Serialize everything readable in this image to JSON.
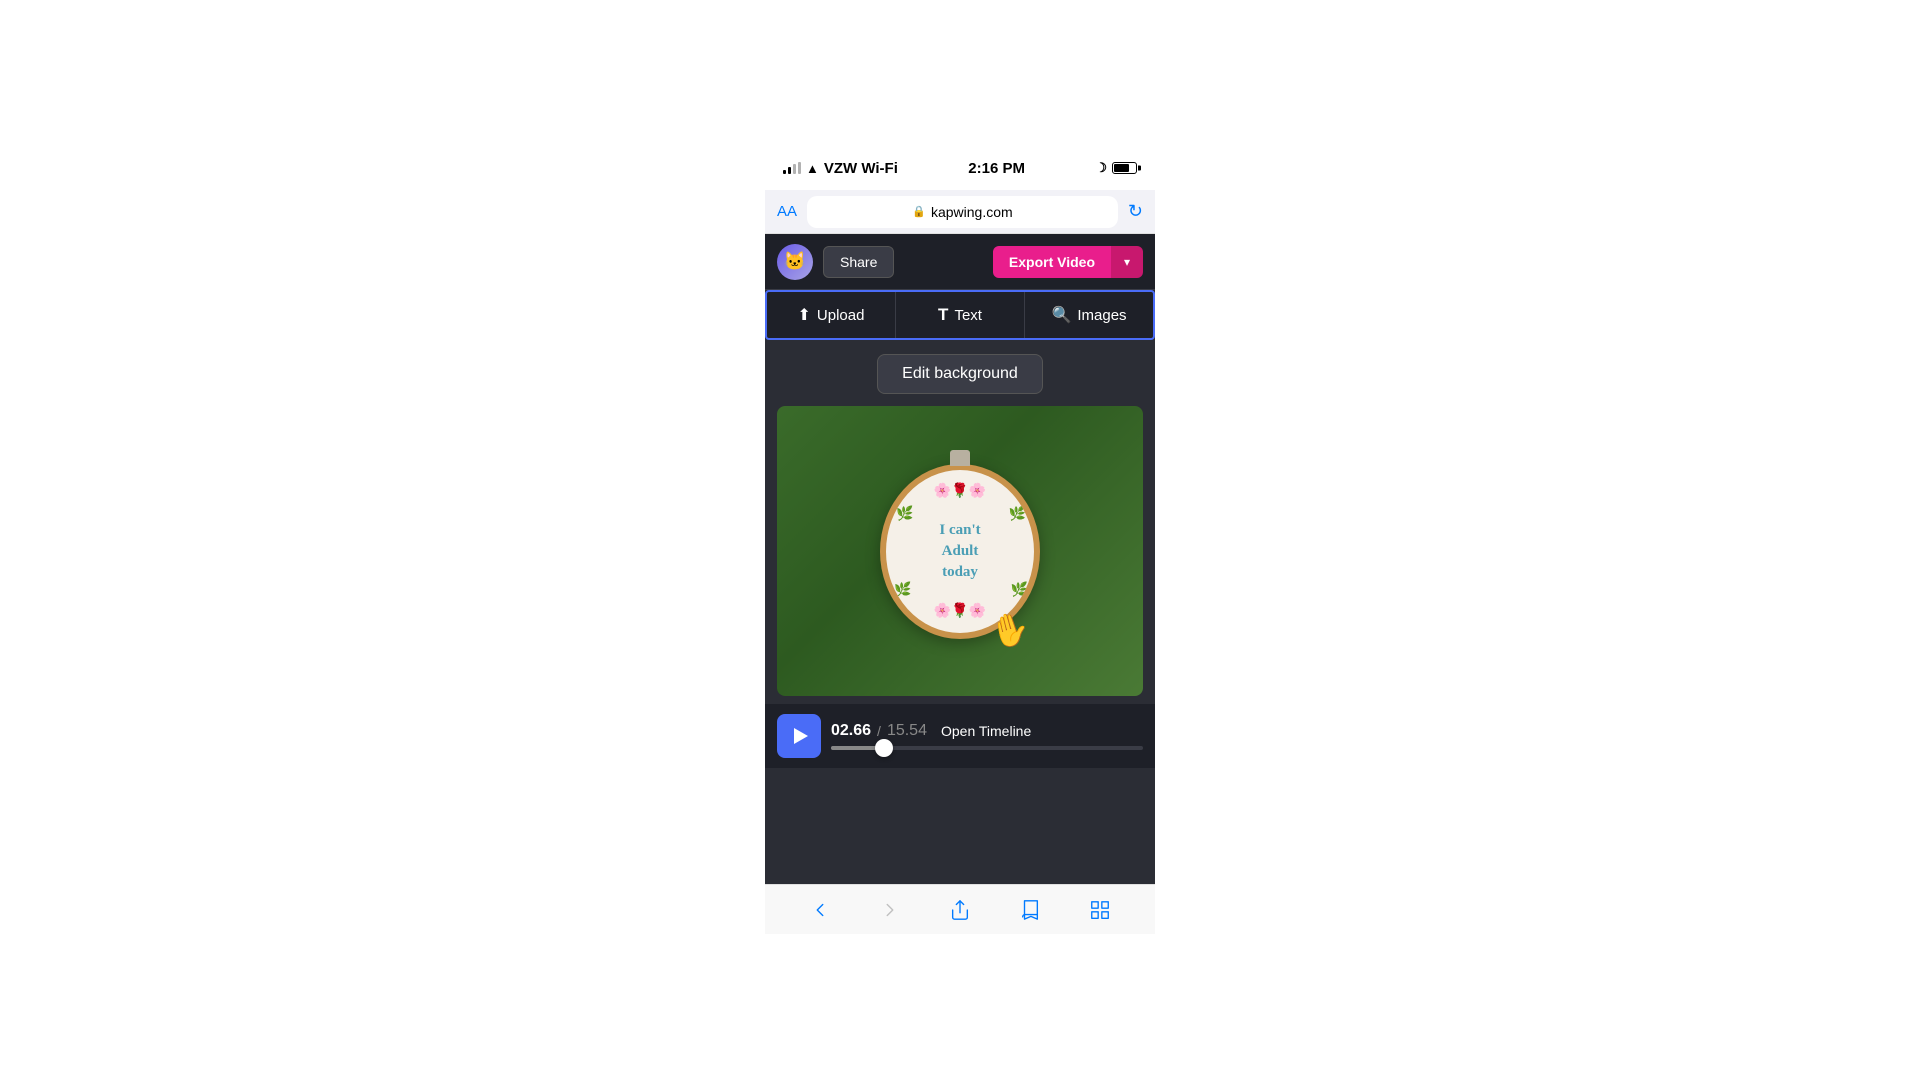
{
  "status_bar": {
    "carrier": "VZW Wi-Fi",
    "time": "2:16 PM",
    "wifi_symbol": "📶"
  },
  "browser": {
    "aa_label": "AA",
    "url": "kapwing.com",
    "lock_symbol": "🔒",
    "refresh_symbol": "↻"
  },
  "top_nav": {
    "share_label": "Share",
    "export_label": "Export Video",
    "dropdown_symbol": "▾",
    "avatar_emoji": "🐱"
  },
  "toolbar": {
    "upload_label": "Upload",
    "upload_icon": "⬆",
    "text_label": "Text",
    "text_icon": "T",
    "images_label": "Images",
    "images_icon": "🔍"
  },
  "edit_background": {
    "label": "Edit background"
  },
  "video": {
    "embroidery_line1": "I can't",
    "embroidery_line2": "Adult",
    "embroidery_line3": "today"
  },
  "timeline": {
    "current_time": "02.66",
    "separator": "/",
    "total_time": "15.54",
    "open_timeline_label": "Open Timeline",
    "progress_percent": 17
  }
}
